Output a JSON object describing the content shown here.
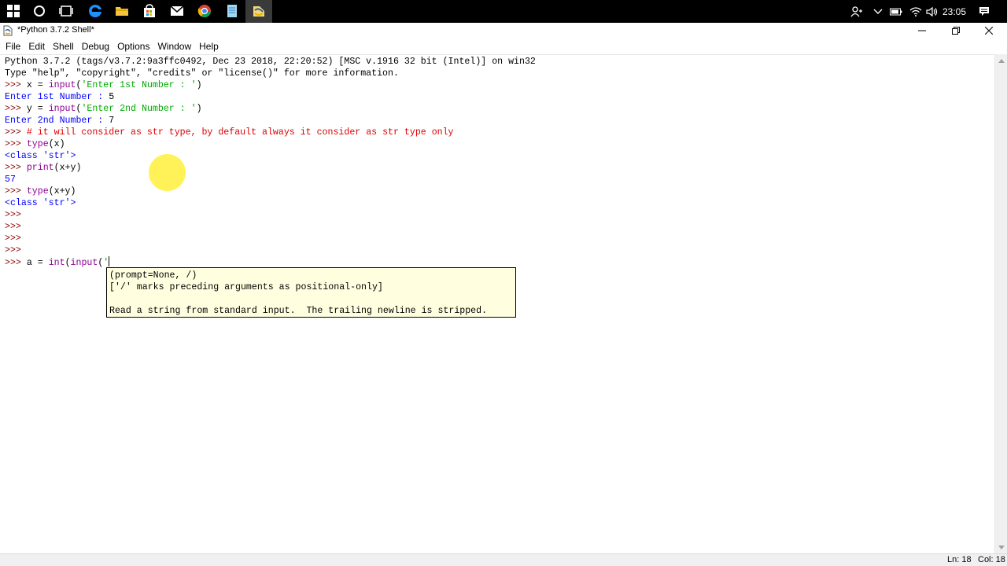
{
  "taskbar": {
    "icons": [
      "windows-start-icon",
      "cortana-search-icon",
      "task-view-icon",
      "edge-browser-icon",
      "file-explorer-icon",
      "store-icon",
      "mail-icon",
      "chrome-icon",
      "notepad-icon",
      "python-idle-icon"
    ],
    "clock": "23:05"
  },
  "window": {
    "title": "*Python 3.7.2 Shell*"
  },
  "menu": [
    "File",
    "Edit",
    "Shell",
    "Debug",
    "Options",
    "Window",
    "Help"
  ],
  "editor": {
    "lines": [
      [
        {
          "t": "Python 3.7.2 (tags/v3.7.2:9a3ffc0492, Dec 23 2018, 22:20:52) [MSC v.1916 32 bit (Intel)] on win32",
          "c": "default"
        }
      ],
      [
        {
          "t": "Type \"help\", \"copyright\", \"credits\" or \"license()\" for more information.",
          "c": "default"
        }
      ],
      [
        {
          "t": ">>> ",
          "c": "prompt"
        },
        {
          "t": "x = ",
          "c": "code"
        },
        {
          "t": "input",
          "c": "builtin"
        },
        {
          "t": "(",
          "c": "code"
        },
        {
          "t": "'Enter 1st Number : '",
          "c": "string"
        },
        {
          "t": ")",
          "c": "code"
        }
      ],
      [
        {
          "t": "Enter 1st Number : ",
          "c": "stdout"
        },
        {
          "t": "5",
          "c": "code"
        }
      ],
      [
        {
          "t": ">>> ",
          "c": "prompt"
        },
        {
          "t": "y = ",
          "c": "code"
        },
        {
          "t": "input",
          "c": "builtin"
        },
        {
          "t": "(",
          "c": "code"
        },
        {
          "t": "'Enter 2nd Number : '",
          "c": "string"
        },
        {
          "t": ")",
          "c": "code"
        }
      ],
      [
        {
          "t": "Enter 2nd Number : ",
          "c": "stdout"
        },
        {
          "t": "7",
          "c": "code"
        }
      ],
      [
        {
          "t": ">>> ",
          "c": "prompt"
        },
        {
          "t": "# it will consider as str type, by default always it consider as str type only",
          "c": "comment"
        }
      ],
      [
        {
          "t": ">>> ",
          "c": "prompt"
        },
        {
          "t": "type",
          "c": "builtin"
        },
        {
          "t": "(x)",
          "c": "code"
        }
      ],
      [
        {
          "t": "<class 'str'>",
          "c": "stdout"
        }
      ],
      [
        {
          "t": ">>> ",
          "c": "prompt"
        },
        {
          "t": "print",
          "c": "builtin"
        },
        {
          "t": "(x+y)",
          "c": "code"
        }
      ],
      [
        {
          "t": "57",
          "c": "stdout"
        }
      ],
      [
        {
          "t": ">>> ",
          "c": "prompt"
        },
        {
          "t": "type",
          "c": "builtin"
        },
        {
          "t": "(x+y)",
          "c": "code"
        }
      ],
      [
        {
          "t": "<class 'str'>",
          "c": "stdout"
        }
      ],
      [
        {
          "t": ">>> ",
          "c": "prompt"
        }
      ],
      [
        {
          "t": ">>> ",
          "c": "prompt"
        }
      ],
      [
        {
          "t": ">>> ",
          "c": "prompt"
        }
      ],
      [
        {
          "t": ">>> ",
          "c": "prompt"
        }
      ],
      [
        {
          "t": ">>> ",
          "c": "prompt"
        },
        {
          "t": "a = ",
          "c": "code"
        },
        {
          "t": "int",
          "c": "builtin"
        },
        {
          "t": "(",
          "c": "code"
        },
        {
          "t": "input",
          "c": "builtin"
        },
        {
          "t": "(",
          "c": "code"
        },
        {
          "t": "'",
          "c": "string"
        }
      ]
    ]
  },
  "calltip": {
    "signature": "(prompt=None, /)",
    "note": "['/' marks preceding arguments as positional-only]",
    "doc": "Read a string from standard input.  The trailing newline is stripped."
  },
  "status": {
    "ln": "Ln: 18",
    "col": "Col: 18"
  },
  "colors": {
    "prompt": "#8b0000",
    "builtin": "#900090",
    "string": "#00aa00",
    "stdout": "#0000ff",
    "comment": "#dd0000",
    "calltip_bg": "#ffffe0"
  }
}
